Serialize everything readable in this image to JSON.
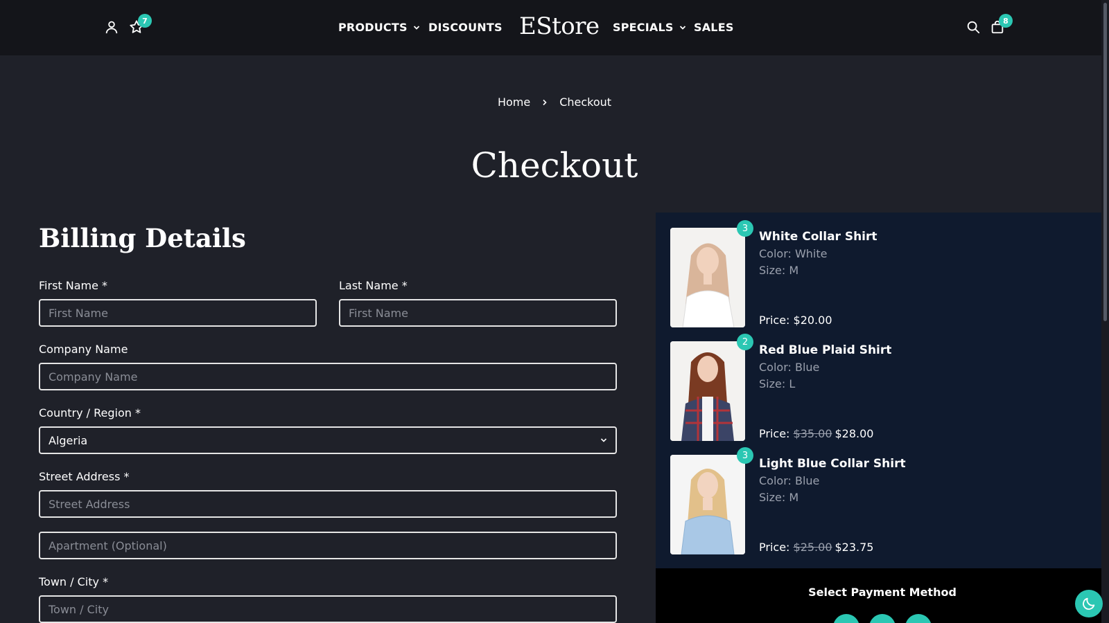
{
  "header": {
    "logo": "EStore",
    "wishlist_count": "7",
    "cart_count": "8",
    "nav": {
      "products": "PRODUCTS",
      "discounts": "DISCOUNTS",
      "specials": "SPECIALS",
      "sales": "SALES"
    },
    "icons": [
      "user-icon",
      "star-icon",
      "search-icon",
      "shopping-bag-icon"
    ]
  },
  "breadcrumb": {
    "home": "Home",
    "current": "Checkout"
  },
  "page_title": "Checkout",
  "billing": {
    "title": "Billing Details",
    "first_name": {
      "label": "First Name *",
      "placeholder": "First Name"
    },
    "last_name": {
      "label": "Last Name *",
      "placeholder": "First Name"
    },
    "company": {
      "label": "Company Name",
      "placeholder": "Company Name"
    },
    "country": {
      "label": "Country / Region *",
      "value": "Algeria"
    },
    "street": {
      "label": "Street Address *",
      "placeholder": "Street Address"
    },
    "apartment": {
      "placeholder": "Apartment (Optional)"
    },
    "city": {
      "label": "Town / City *",
      "placeholder": "Town / City"
    }
  },
  "order_items": [
    {
      "qty": "3",
      "name": "White Collar Shirt",
      "color": "Color: White",
      "size": "Size: M",
      "price_label": "Price:",
      "old_price": "",
      "price": "$20.00"
    },
    {
      "qty": "2",
      "name": "Red Blue Plaid Shirt",
      "color": "Color: Blue",
      "size": "Size: L",
      "price_label": "Price:",
      "old_price": "$35.00",
      "price": "$28.00"
    },
    {
      "qty": "3",
      "name": "Light Blue Collar Shirt",
      "color": "Color: Blue",
      "size": "Size: M",
      "price_label": "Price:",
      "old_price": "$25.00",
      "price": "$23.75"
    }
  ],
  "payment": {
    "title": "Select Payment Method"
  },
  "colors": {
    "accent": "#2bc7b3",
    "background": "#1f2129",
    "header": "#14151a",
    "summary_panel": "#0f1a2e"
  }
}
